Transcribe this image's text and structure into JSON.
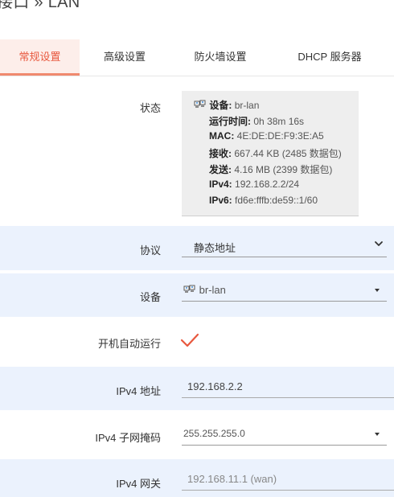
{
  "page": {
    "title": "接口 » LAN"
  },
  "tabs": [
    {
      "label": "常规设置",
      "active": true
    },
    {
      "label": "高级设置",
      "active": false
    },
    {
      "label": "防火墙设置",
      "active": false
    },
    {
      "label": "DHCP 服务器",
      "active": false
    }
  ],
  "status": {
    "label": "状态",
    "device_key": "设备:",
    "device_val": "br-lan",
    "uptime_key": "运行时间:",
    "uptime_val": "0h 38m 16s",
    "mac_key": "MAC:",
    "mac_val": "4E:DE:DE:F9:3E:A5",
    "rx_key": "接收:",
    "rx_val": "667.44 KB (2485 数据包)",
    "tx_key": "发送:",
    "tx_val": "4.16 MB (2399 数据包)",
    "ipv4_key": "IPv4:",
    "ipv4_val": "192.168.2.2/24",
    "ipv6_key": "IPv6:",
    "ipv6_val": "fd6e:fffb:de59::1/60"
  },
  "protocol": {
    "label": "协议",
    "value": "静态地址"
  },
  "device": {
    "label": "设备",
    "value": "br-lan"
  },
  "autostart": {
    "label": "开机自动运行",
    "checked": true
  },
  "ipv4_addr": {
    "label": "IPv4 地址",
    "value": "192.168.2.2"
  },
  "ipv4_mask": {
    "label": "IPv4 子网掩码",
    "value": "255.255.255.0"
  },
  "ipv4_gw": {
    "label": "IPv4 网关",
    "placeholder": "192.168.11.1 (wan)"
  },
  "colors": {
    "accent": "#e8583e",
    "tab_active_bg": "#fdeeea",
    "row_alt_bg": "#ebf2fd",
    "status_bg": "#eeeeee"
  }
}
